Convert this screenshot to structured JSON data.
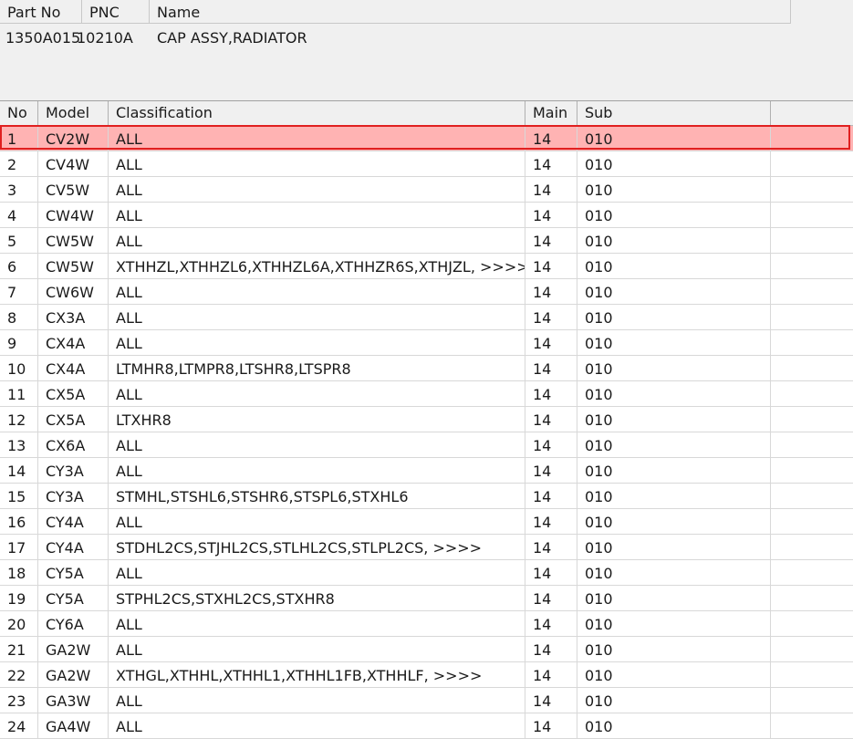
{
  "part_info": {
    "headers": {
      "part_no": "Part No",
      "pnc": "PNC",
      "name": "Name"
    },
    "values": {
      "part_no": "1350A015",
      "pnc": "10210A",
      "name": "CAP ASSY,RADIATOR"
    }
  },
  "grid": {
    "columns": {
      "no": "No",
      "model": "Model",
      "classification": "Classification",
      "main": "Main",
      "sub": "Sub"
    },
    "selected_row_index": 0,
    "selection_color": "#ffb3b3",
    "selection_border": "#e02020",
    "rows": [
      {
        "no": "1",
        "model": "CV2W",
        "classification": "ALL",
        "main": "14",
        "sub": "010"
      },
      {
        "no": "2",
        "model": "CV4W",
        "classification": "ALL",
        "main": "14",
        "sub": "010"
      },
      {
        "no": "3",
        "model": "CV5W",
        "classification": "ALL",
        "main": "14",
        "sub": "010"
      },
      {
        "no": "4",
        "model": "CW4W",
        "classification": "ALL",
        "main": "14",
        "sub": "010"
      },
      {
        "no": "5",
        "model": "CW5W",
        "classification": "ALL",
        "main": "14",
        "sub": "010"
      },
      {
        "no": "6",
        "model": "CW5W",
        "classification": "XTHHZL,XTHHZL6,XTHHZL6A,XTHHZR6S,XTHJZL,  >>>>",
        "main": "14",
        "sub": "010"
      },
      {
        "no": "7",
        "model": "CW6W",
        "classification": "ALL",
        "main": "14",
        "sub": "010"
      },
      {
        "no": "8",
        "model": "CX3A",
        "classification": "ALL",
        "main": "14",
        "sub": "010"
      },
      {
        "no": "9",
        "model": "CX4A",
        "classification": "ALL",
        "main": "14",
        "sub": "010"
      },
      {
        "no": "10",
        "model": "CX4A",
        "classification": "LTMHR8,LTMPR8,LTSHR8,LTSPR8",
        "main": "14",
        "sub": "010"
      },
      {
        "no": "11",
        "model": "CX5A",
        "classification": "ALL",
        "main": "14",
        "sub": "010"
      },
      {
        "no": "12",
        "model": "CX5A",
        "classification": "LTXHR8",
        "main": "14",
        "sub": "010"
      },
      {
        "no": "13",
        "model": "CX6A",
        "classification": "ALL",
        "main": "14",
        "sub": "010"
      },
      {
        "no": "14",
        "model": "CY3A",
        "classification": "ALL",
        "main": "14",
        "sub": "010"
      },
      {
        "no": "15",
        "model": "CY3A",
        "classification": "STMHL,STSHL6,STSHR6,STSPL6,STXHL6",
        "main": "14",
        "sub": "010"
      },
      {
        "no": "16",
        "model": "CY4A",
        "classification": "ALL",
        "main": "14",
        "sub": "010"
      },
      {
        "no": "17",
        "model": "CY4A",
        "classification": "STDHL2CS,STJHL2CS,STLHL2CS,STLPL2CS,  >>>>",
        "main": "14",
        "sub": "010"
      },
      {
        "no": "18",
        "model": "CY5A",
        "classification": "ALL",
        "main": "14",
        "sub": "010"
      },
      {
        "no": "19",
        "model": "CY5A",
        "classification": "STPHL2CS,STXHL2CS,STXHR8",
        "main": "14",
        "sub": "010"
      },
      {
        "no": "20",
        "model": "CY6A",
        "classification": "ALL",
        "main": "14",
        "sub": "010"
      },
      {
        "no": "21",
        "model": "GA2W",
        "classification": "ALL",
        "main": "14",
        "sub": "010"
      },
      {
        "no": "22",
        "model": "GA2W",
        "classification": "XTHGL,XTHHL,XTHHL1,XTHHL1FB,XTHHLF,  >>>>",
        "main": "14",
        "sub": "010"
      },
      {
        "no": "23",
        "model": "GA3W",
        "classification": "ALL",
        "main": "14",
        "sub": "010"
      },
      {
        "no": "24",
        "model": "GA4W",
        "classification": "ALL",
        "main": "14",
        "sub": "010"
      }
    ]
  }
}
